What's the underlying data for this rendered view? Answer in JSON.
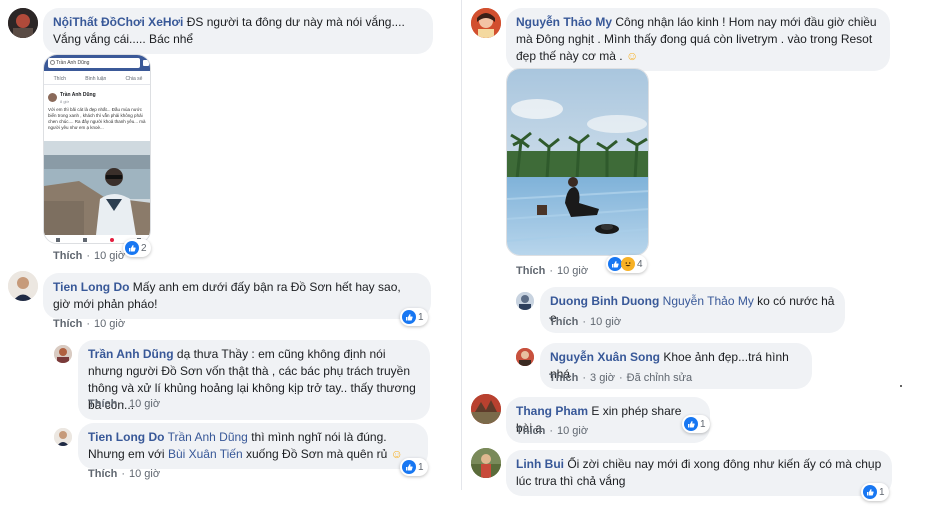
{
  "comments": [
    {
      "author": "NộiThất ĐồChơi XeHơi",
      "text": "ĐS người ta đông dư này mà nói vắng.... Vắng vắng cái..... Bác nhể"
    },
    {
      "author": "Tien Long Do",
      "text": "Mấy anh em dưới đấy bận ra Đồ Sơn hết hay sao, giờ mới phản pháo!",
      "time": "10 giờ",
      "reactions": "1"
    },
    {
      "author": "Trần Anh Dũng",
      "text": "dạ thưa Thầy : em cũng không định nói nhưng người Đồ Sơn vốn thật thà , các bác phụ trách truyền thông và xử lí khủng hoảng lại không kịp trở tay.. thấy thương bà con...",
      "time": "10 giờ"
    },
    {
      "author": "Tien Long Do",
      "mention1": "Trần Anh Dũng",
      "text1": "thì mình nghĩ nói là đúng. Nhưng em với",
      "mention2": "Bùi Xuân Tiến",
      "text2": "xuống Đồ Sơn mà quên rủ",
      "emoji": "☺",
      "time": "10 giờ",
      "reactions": "1"
    },
    {
      "author": "Nguyễn Thảo My",
      "text": "Công nhận láo kinh ! Hom nay mới đầu giờ chiều mà Đông nghịt . Mình thấy đong quá còn livetrym . vào trong Resot đẹp thế này cơ mà .",
      "emoji": "☺",
      "time": "10 giờ",
      "reactions": "4"
    },
    {
      "author": "Duong Binh Duong",
      "mention": "Nguyễn Thảo My",
      "text": "ko có nước hả e",
      "time": "10 giờ"
    },
    {
      "author": "Nguyễn Xuân Song",
      "text": "Khoe ảnh đẹp...trá hình nhá",
      "time": "3 giờ",
      "edited": "Đã chỉnh sửa"
    },
    {
      "author": "Thang Pham",
      "text": "E xin phép share bài a",
      "time": "10 giờ",
      "reactions": "1"
    },
    {
      "author": "Linh Bui",
      "text": "Ối zời chiều nay mới đi xong đông như kiến ấy có mà chụp lúc trưa thì chả vắng",
      "time": "10 giờ",
      "reactions": "1"
    }
  ],
  "first_photo": {
    "time": "10 giờ",
    "reactions": "2"
  },
  "labels": {
    "like": "Thích"
  },
  "screenshot": {
    "search_text": "Trần Anh Dũng",
    "tab_like": "Thích",
    "tab_comment": "Bình luận",
    "tab_share": "Chia sẻ",
    "post_author": "Trần Anh Dũng",
    "post_meta": "8 giờ",
    "post_text": "Với em thì bãi cát là đẹp nhất... Đầu mùa nước biển trong xanh , khách thì vẫn phải không phải chen chúc.... Ra đây người khoả thanh yêu... mà người yêu như em ạ knoè..."
  },
  "colors": {
    "link": "#385898",
    "bubble": "#f0f2f5",
    "meta": "#606770",
    "like": "#1877f2"
  }
}
